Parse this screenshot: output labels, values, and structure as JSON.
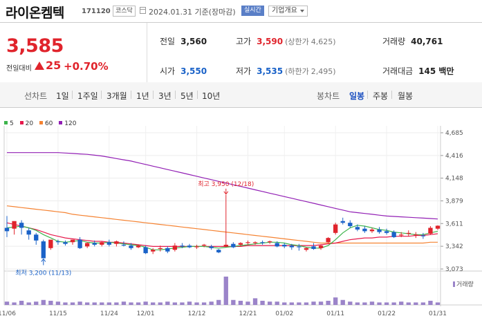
{
  "header": {
    "name": "라이온켐텍",
    "code": "171120",
    "market": "코스닥",
    "date_text": "2024.01.31 기준(장마감)",
    "realtime_label": "실시간",
    "info_dropdown": "기업개요"
  },
  "quote": {
    "current": "3,585",
    "prev_diff_label": "전일대비",
    "change": "25",
    "change_pct": "+0.70%",
    "prev_close_label": "전일",
    "prev_close": "3,560",
    "open_label": "시가",
    "open": "3,550",
    "high_label": "고가",
    "high": "3,590",
    "upper_limit_label": "(상한가",
    "upper_limit": "4,625)",
    "low_label": "저가",
    "low": "3,535",
    "lower_limit_label": "(하한가",
    "lower_limit": "2,495)",
    "volume_label": "거래량",
    "volume": "40,761",
    "amount_label": "거래대금",
    "amount": "145 백만"
  },
  "tabs": {
    "line_label": "선차트",
    "line_items": [
      "1일",
      "1주일",
      "3개월",
      "1년",
      "3년",
      "5년",
      "10년"
    ],
    "candle_label": "봉차트",
    "candle_items": [
      "일봉",
      "주봉",
      "월봉"
    ],
    "selected": "일봉"
  },
  "colors": {
    "up": "#e0242c",
    "down": "#1a62c8",
    "ma5": "#3cb44b",
    "ma20": "#e6194b",
    "ma60": "#f58231",
    "ma120": "#911eb4",
    "volume": "#9b84c9"
  },
  "chart_data": {
    "type": "candlestick",
    "legend": [
      "5",
      "20",
      "60",
      "120"
    ],
    "y_ticks": [
      "4,685",
      "4,416",
      "4,148",
      "3,879",
      "3,611",
      "3,342",
      "3,073"
    ],
    "ylim": [
      3073,
      4685
    ],
    "x_labels": [
      {
        "label": "11/06",
        "index": 0
      },
      {
        "label": "11/15",
        "index": 7
      },
      {
        "label": "11/24",
        "index": 14
      },
      {
        "label": "12/01",
        "index": 19
      },
      {
        "label": "12/12",
        "index": 26
      },
      {
        "label": "12/21",
        "index": 33
      },
      {
        "label": "01/02",
        "index": 38
      },
      {
        "label": "01/11",
        "index": 45
      },
      {
        "label": "01/22",
        "index": 52
      },
      {
        "label": "01/31",
        "index": 59
      }
    ],
    "annotations": [
      {
        "label": "최고 3,950 (12/18)",
        "index": 30,
        "value": 3950,
        "color": "#e0242c",
        "position": "above"
      },
      {
        "label": "최저 3,200 (11/13)",
        "index": 5,
        "value": 3200,
        "color": "#1a62c8",
        "position": "below"
      }
    ],
    "volume_legend": "거래량",
    "candles": [
      [
        3560,
        3700,
        3520,
        3450
      ],
      [
        3550,
        3600,
        3640,
        3480
      ],
      [
        3620,
        3650,
        3560,
        3480
      ],
      [
        3530,
        3560,
        3480,
        3420
      ],
      [
        3480,
        3500,
        3410,
        3360
      ],
      [
        3400,
        3420,
        3200,
        3200
      ],
      [
        3320,
        3380,
        3420,
        3300
      ],
      [
        3400,
        3420,
        3390,
        3360
      ],
      [
        3390,
        3410,
        3370,
        3350
      ],
      [
        3390,
        3420,
        3420,
        3360
      ],
      [
        3420,
        3450,
        3320,
        3310
      ],
      [
        3340,
        3390,
        3380,
        3320
      ],
      [
        3380,
        3410,
        3360,
        3340
      ],
      [
        3360,
        3400,
        3390,
        3340
      ],
      [
        3390,
        3420,
        3360,
        3340
      ],
      [
        3370,
        3410,
        3400,
        3340
      ],
      [
        3360,
        3400,
        3350,
        3340
      ],
      [
        3350,
        3380,
        3320,
        3300
      ],
      [
        3330,
        3360,
        3350,
        3320
      ],
      [
        3330,
        3350,
        3260,
        3250
      ],
      [
        3280,
        3320,
        3300,
        3250
      ],
      [
        3310,
        3350,
        3320,
        3280
      ],
      [
        3320,
        3340,
        3280,
        3260
      ],
      [
        3300,
        3380,
        3350,
        3280
      ],
      [
        3350,
        3380,
        3340,
        3320
      ],
      [
        3350,
        3370,
        3330,
        3320
      ],
      [
        3330,
        3360,
        3340,
        3310
      ],
      [
        3350,
        3370,
        3360,
        3330
      ],
      [
        3340,
        3360,
        3320,
        3300
      ],
      [
        3300,
        3310,
        3270,
        3260
      ],
      [
        3340,
        3950,
        3360,
        3330
      ],
      [
        3370,
        3390,
        3330,
        3320
      ],
      [
        3360,
        3390,
        3380,
        3340
      ],
      [
        3380,
        3410,
        3390,
        3360
      ],
      [
        3380,
        3400,
        3390,
        3360
      ],
      [
        3390,
        3410,
        3380,
        3360
      ],
      [
        3390,
        3410,
        3400,
        3370
      ],
      [
        3380,
        3400,
        3340,
        3330
      ],
      [
        3360,
        3380,
        3340,
        3320
      ],
      [
        3350,
        3370,
        3330,
        3300
      ],
      [
        3340,
        3370,
        3330,
        3290
      ],
      [
        3300,
        3330,
        3320,
        3280
      ],
      [
        3340,
        3380,
        3310,
        3300
      ],
      [
        3320,
        3360,
        3350,
        3300
      ],
      [
        3390,
        3450,
        3440,
        3380
      ],
      [
        3500,
        3620,
        3600,
        3480
      ],
      [
        3640,
        3680,
        3620,
        3600
      ],
      [
        3620,
        3650,
        3580,
        3560
      ],
      [
        3570,
        3600,
        3540,
        3520
      ],
      [
        3550,
        3580,
        3520,
        3500
      ],
      [
        3520,
        3560,
        3540,
        3500
      ],
      [
        3540,
        3570,
        3510,
        3490
      ],
      [
        3520,
        3550,
        3500,
        3480
      ],
      [
        3510,
        3530,
        3450,
        3440
      ],
      [
        3470,
        3510,
        3480,
        3450
      ],
      [
        3490,
        3530,
        3500,
        3460
      ],
      [
        3480,
        3510,
        3480,
        3440
      ],
      [
        3470,
        3500,
        3460,
        3430
      ],
      [
        3490,
        3580,
        3560,
        3480
      ],
      [
        3550,
        3590,
        3585,
        3535
      ]
    ],
    "ma5": [
      3560,
      3570,
      3580,
      3560,
      3530,
      3480,
      3440,
      3400,
      3390,
      3400,
      3410,
      3390,
      3380,
      3380,
      3390,
      3380,
      3370,
      3360,
      3350,
      3330,
      3300,
      3300,
      3310,
      3320,
      3330,
      3340,
      3340,
      3340,
      3330,
      3320,
      3330,
      3340,
      3350,
      3360,
      3370,
      3380,
      3390,
      3390,
      3380,
      3360,
      3350,
      3330,
      3320,
      3320,
      3350,
      3420,
      3500,
      3560,
      3590,
      3580,
      3560,
      3540,
      3530,
      3510,
      3500,
      3490,
      3480,
      3480,
      3500,
      3520
    ],
    "ma20": [
      3620,
      3600,
      3580,
      3560,
      3540,
      3510,
      3480,
      3460,
      3440,
      3430,
      3420,
      3410,
      3400,
      3400,
      3390,
      3390,
      3380,
      3370,
      3360,
      3350,
      3340,
      3340,
      3340,
      3340,
      3340,
      3340,
      3340,
      3340,
      3340,
      3340,
      3340,
      3340,
      3340,
      3350,
      3350,
      3350,
      3350,
      3350,
      3350,
      3350,
      3350,
      3350,
      3350,
      3360,
      3370,
      3380,
      3400,
      3420,
      3430,
      3440,
      3440,
      3450,
      3450,
      3460,
      3460,
      3460,
      3470,
      3470,
      3480,
      3490
    ],
    "ma60": [
      3820,
      3810,
      3800,
      3790,
      3780,
      3770,
      3760,
      3750,
      3740,
      3720,
      3710,
      3700,
      3690,
      3680,
      3670,
      3660,
      3650,
      3640,
      3630,
      3620,
      3610,
      3600,
      3590,
      3580,
      3570,
      3560,
      3550,
      3540,
      3530,
      3520,
      3510,
      3500,
      3490,
      3480,
      3470,
      3460,
      3450,
      3440,
      3430,
      3420,
      3410,
      3400,
      3390,
      3380,
      3380,
      3380,
      3380,
      3380,
      3380,
      3380,
      3380,
      3380,
      3380,
      3380,
      3380,
      3380,
      3380,
      3380,
      3390,
      3390
    ],
    "ma120": [
      4450,
      4450,
      4450,
      4450,
      4450,
      4450,
      4450,
      4450,
      4445,
      4440,
      4435,
      4430,
      4420,
      4410,
      4395,
      4380,
      4365,
      4350,
      4330,
      4310,
      4290,
      4270,
      4250,
      4230,
      4210,
      4190,
      4170,
      4150,
      4130,
      4110,
      4090,
      4070,
      4050,
      4030,
      4010,
      3990,
      3970,
      3950,
      3930,
      3910,
      3890,
      3870,
      3850,
      3830,
      3810,
      3790,
      3770,
      3750,
      3740,
      3730,
      3720,
      3710,
      3700,
      3695,
      3690,
      3685,
      3680,
      3675,
      3670,
      3665
    ],
    "volumes": [
      4,
      3,
      5,
      3,
      4,
      6,
      5,
      4,
      3,
      3,
      4,
      3,
      3,
      3,
      3,
      3,
      4,
      3,
      3,
      4,
      3,
      3,
      4,
      3,
      3,
      4,
      3,
      3,
      4,
      6,
      34,
      6,
      5,
      4,
      8,
      5,
      4,
      4,
      3,
      3,
      3,
      3,
      4,
      4,
      5,
      9,
      6,
      4,
      3,
      3,
      4,
      3,
      3,
      3,
      4,
      3,
      3,
      3,
      5,
      3
    ]
  }
}
